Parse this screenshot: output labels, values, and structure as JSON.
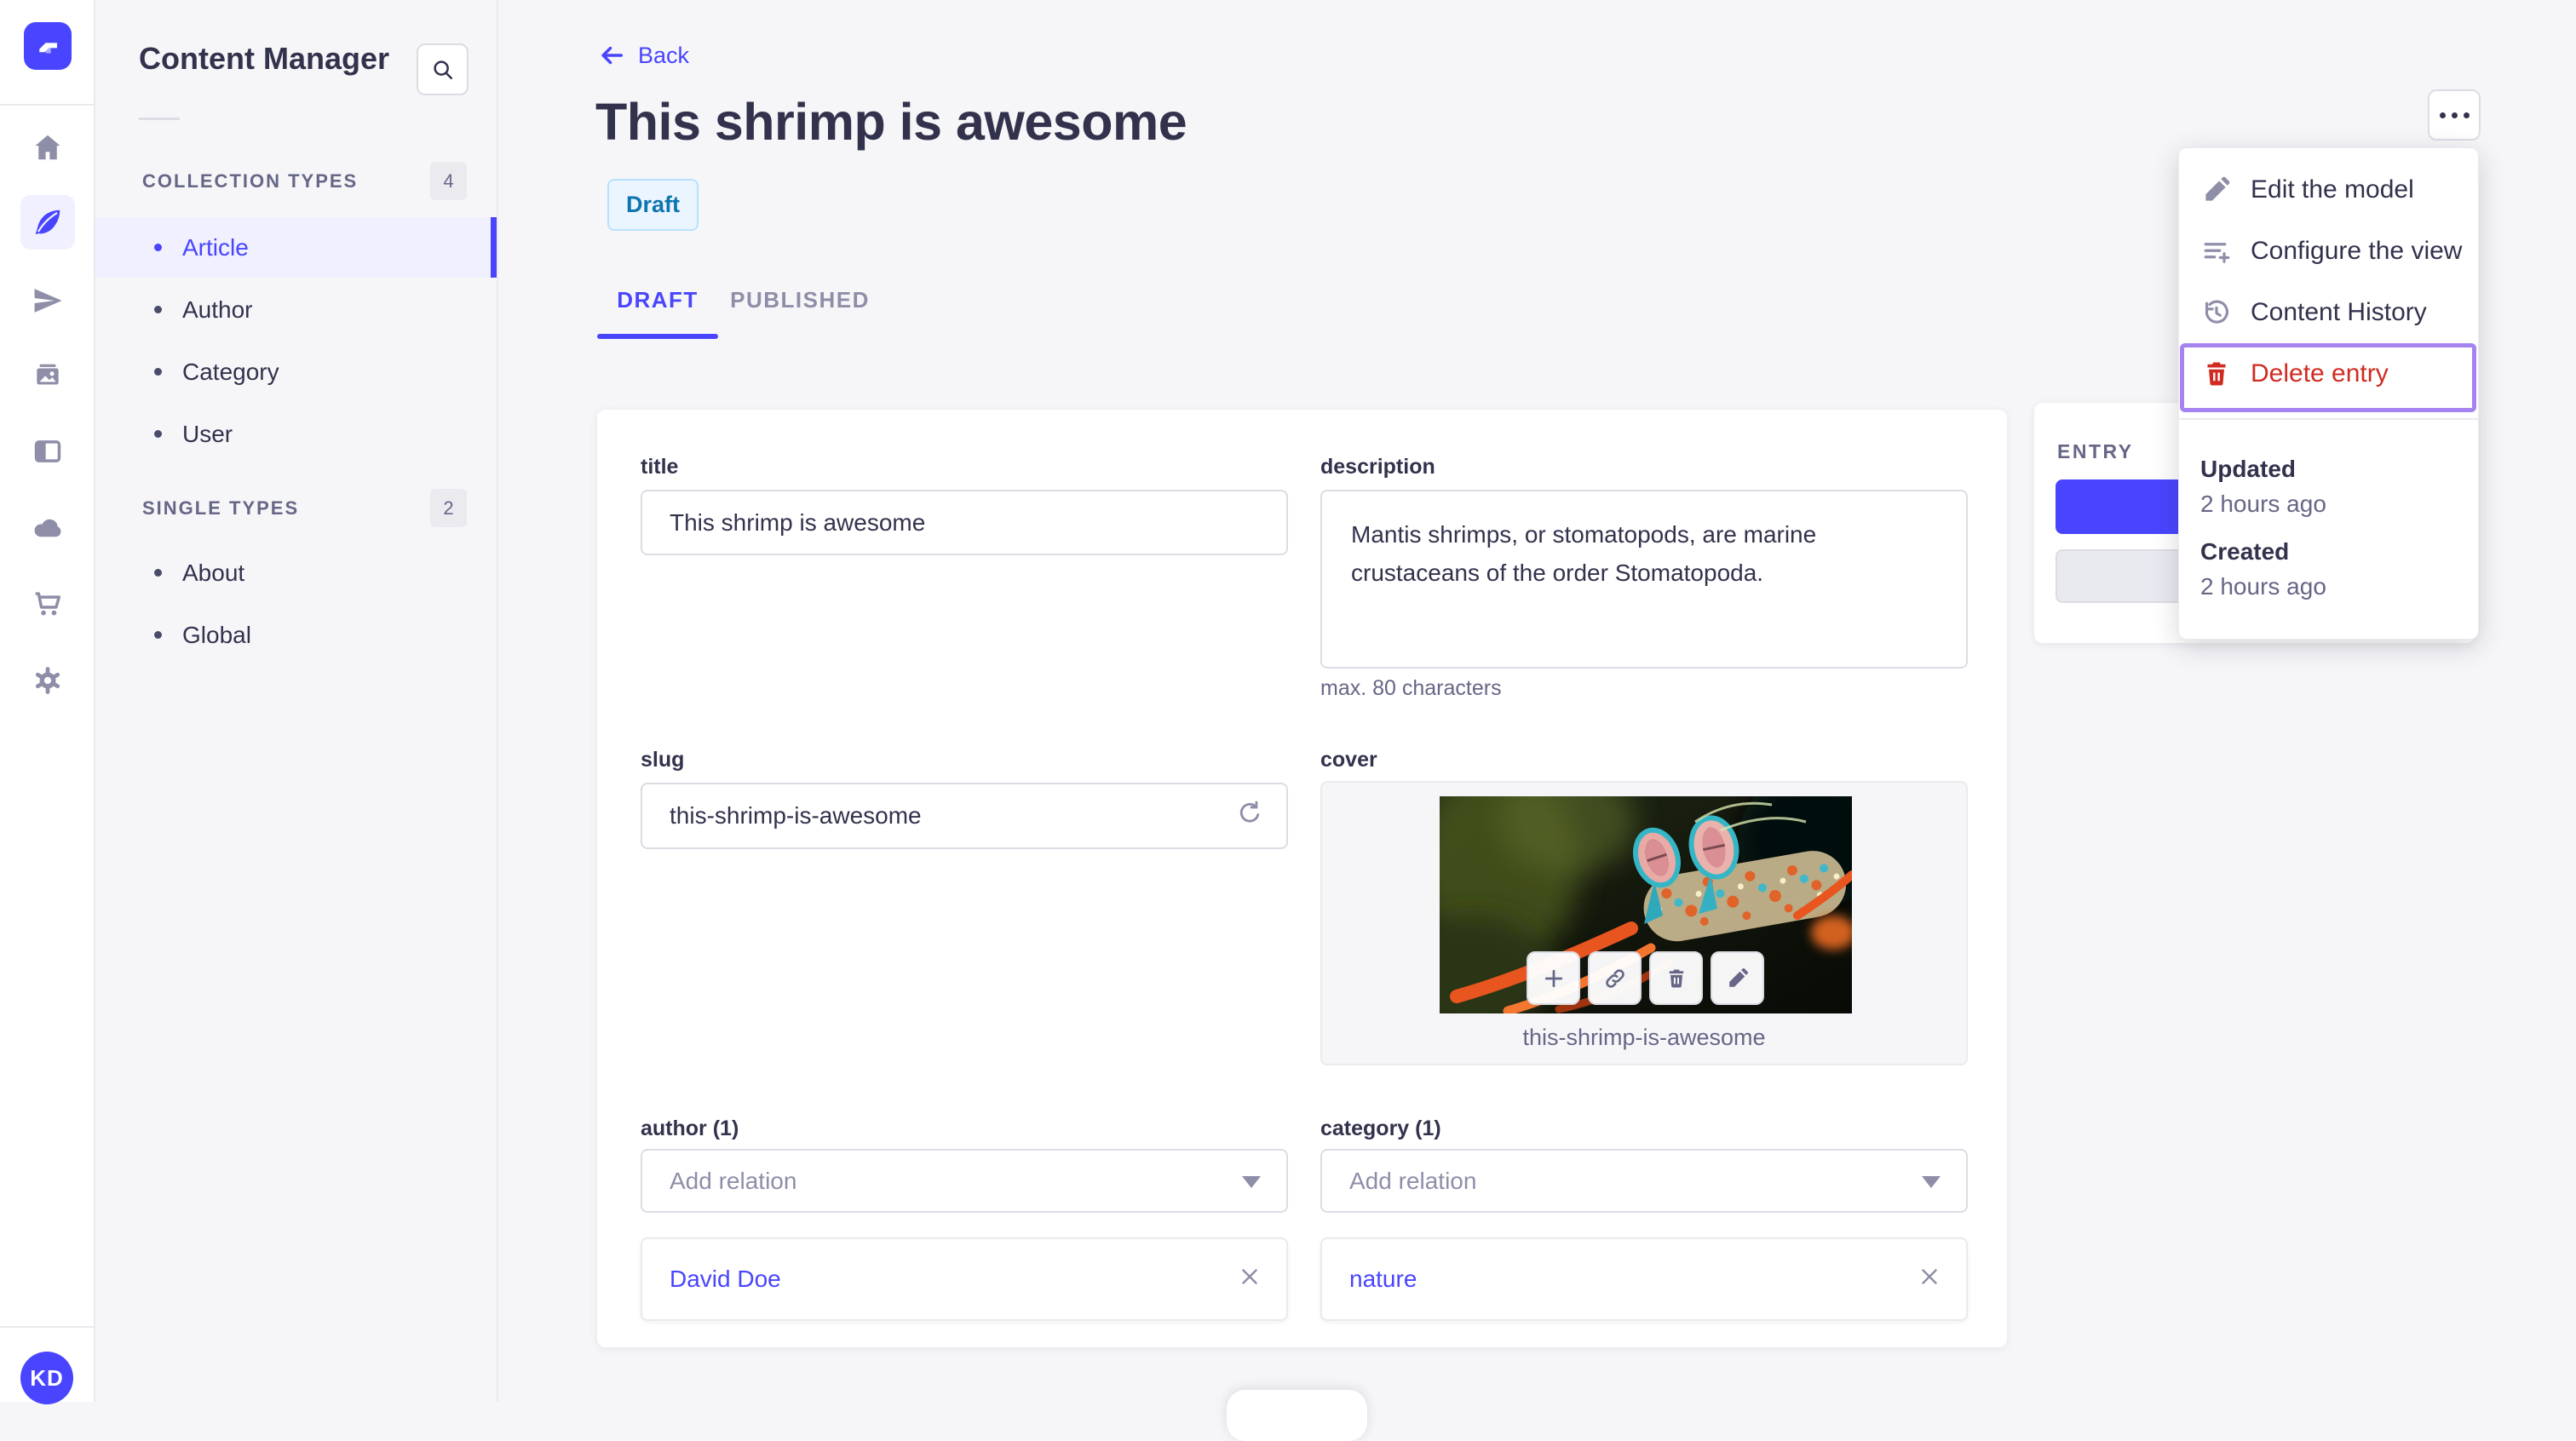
{
  "colors": {
    "accent": "#4945ff",
    "accent_light_bg": "#f0f0ff",
    "danger": "#d02b20",
    "highlight_ring": "#a583f0",
    "draft_text": "#0c75af",
    "draft_bg": "#eaf5ff",
    "draft_border": "#b8e1ff",
    "background": "#f6f6f9"
  },
  "icon_sidebar": {
    "logo_icon": "strapi-logo",
    "items": [
      {
        "icon": "home-icon",
        "active": false
      },
      {
        "icon": "content-feather-icon",
        "active": true
      },
      {
        "icon": "paper-plane-icon",
        "active": false
      },
      {
        "icon": "media-images-icon",
        "active": false
      },
      {
        "icon": "layout-icon",
        "active": false
      },
      {
        "icon": "cloud-icon",
        "active": false
      },
      {
        "icon": "cart-icon",
        "active": false
      },
      {
        "icon": "gear-icon",
        "active": false
      }
    ],
    "avatar_initials": "KD"
  },
  "sidebar": {
    "title": "Content Manager",
    "search_icon": "search-icon",
    "sections": [
      {
        "label": "COLLECTION TYPES",
        "count": "4",
        "items": [
          {
            "label": "Article",
            "active": true
          },
          {
            "label": "Author",
            "active": false
          },
          {
            "label": "Category",
            "active": false
          },
          {
            "label": "User",
            "active": false
          }
        ]
      },
      {
        "label": "SINGLE TYPES",
        "count": "2",
        "items": [
          {
            "label": "About",
            "active": false
          },
          {
            "label": "Global",
            "active": false
          }
        ]
      }
    ]
  },
  "header": {
    "back_label": "Back",
    "title": "This shrimp is awesome",
    "status_badge": "Draft",
    "tabs": [
      {
        "label": "DRAFT",
        "active": true
      },
      {
        "label": "PUBLISHED",
        "active": false
      }
    ],
    "more_icon": "ellipsis-icon"
  },
  "form": {
    "title": {
      "label": "title",
      "value": "This shrimp is awesome"
    },
    "description": {
      "label": "description",
      "value": "Mantis shrimps, or stomatopods, are marine crustaceans of the order Stomatopoda.",
      "hint": "max. 80 characters"
    },
    "slug": {
      "label": "slug",
      "value": "this-shrimp-is-awesome",
      "refresh_icon": "regenerate-icon"
    },
    "cover": {
      "label": "cover",
      "caption": "this-shrimp-is-awesome",
      "action_icons": [
        "add-icon",
        "link-icon",
        "trash-icon",
        "edit-pencil-icon"
      ]
    },
    "author": {
      "label": "author (1)",
      "placeholder": "Add relation",
      "relations": [
        {
          "name": "David Doe"
        }
      ]
    },
    "category": {
      "label": "category (1)",
      "placeholder": "Add relation",
      "relations": [
        {
          "name": "nature"
        }
      ]
    }
  },
  "entry_panel": {
    "title": "ENTRY"
  },
  "menu": {
    "items": [
      {
        "label": "Edit the model",
        "icon": "edit-pencil-icon",
        "danger": false
      },
      {
        "label": "Configure the view",
        "icon": "configure-list-icon",
        "danger": false
      },
      {
        "label": "Content History",
        "icon": "history-clock-icon",
        "danger": false
      },
      {
        "label": "Delete entry",
        "icon": "trash-icon",
        "danger": true,
        "highlighted": true
      }
    ],
    "meta": [
      {
        "label": "Updated",
        "value": "2 hours ago"
      },
      {
        "label": "Created",
        "value": "2 hours ago"
      }
    ]
  }
}
